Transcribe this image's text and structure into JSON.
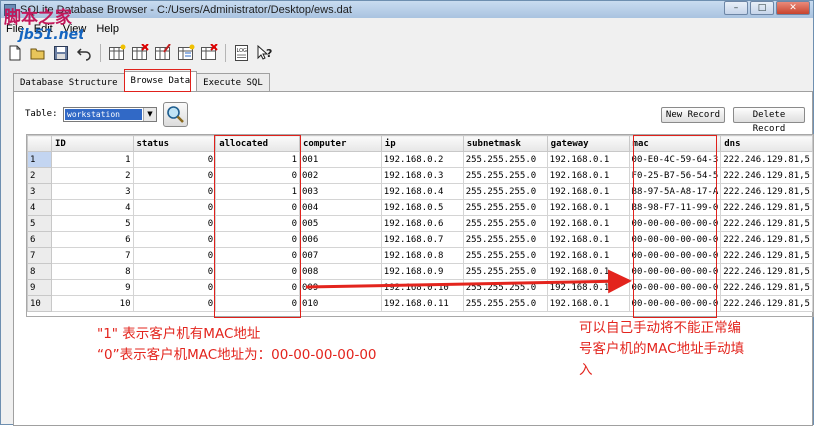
{
  "window": {
    "title": "SQLite Database Browser - C:/Users/Administrator/Desktop/ews.dat"
  },
  "menu": [
    "File",
    "Edit",
    "View",
    "Help"
  ],
  "watermark": {
    "text": "脚本之家",
    "sub": "jb51.net"
  },
  "toolbar": [
    "new-database-icon",
    "open-database-icon",
    "save-database-icon",
    "undo-icon",
    "create-table-icon",
    "delete-table-icon",
    "modify-table-icon",
    "create-index-icon",
    "delete-index-icon",
    "sql-log-icon",
    "whats-this-icon"
  ],
  "tabs": [
    "Database Structure",
    "Browse Data",
    "Execute SQL"
  ],
  "browse": {
    "table_label": "Table:",
    "table_value": "workstation",
    "new_record": "New Record",
    "delete_record": "Delete Record"
  },
  "columns": [
    "ID",
    "status",
    "allocated",
    "computer",
    "ip",
    "subnetmask",
    "gateway",
    "mac",
    "dns"
  ],
  "rows": [
    [
      "1",
      "1",
      "0",
      "1",
      "001",
      "192.168.0.2",
      "255.255.255.0",
      "192.168.0.1",
      "00-E0-4C-59-64-3",
      "222.246.129.81,5"
    ],
    [
      "2",
      "2",
      "0",
      "0",
      "002",
      "192.168.0.3",
      "255.255.255.0",
      "192.168.0.1",
      "F0-25-B7-56-54-5",
      "222.246.129.81,5"
    ],
    [
      "3",
      "3",
      "0",
      "1",
      "003",
      "192.168.0.4",
      "255.255.255.0",
      "192.168.0.1",
      "B8-97-5A-A8-17-A",
      "222.246.129.81,5"
    ],
    [
      "4",
      "4",
      "0",
      "0",
      "004",
      "192.168.0.5",
      "255.255.255.0",
      "192.168.0.1",
      "B8-98-F7-11-99-0",
      "222.246.129.81,5"
    ],
    [
      "5",
      "5",
      "0",
      "0",
      "005",
      "192.168.0.6",
      "255.255.255.0",
      "192.168.0.1",
      "00-00-00-00-00-0",
      "222.246.129.81,5"
    ],
    [
      "6",
      "6",
      "0",
      "0",
      "006",
      "192.168.0.7",
      "255.255.255.0",
      "192.168.0.1",
      "00-00-00-00-00-0",
      "222.246.129.81,5"
    ],
    [
      "7",
      "7",
      "0",
      "0",
      "007",
      "192.168.0.8",
      "255.255.255.0",
      "192.168.0.1",
      "00-00-00-00-00-0",
      "222.246.129.81,5"
    ],
    [
      "8",
      "8",
      "0",
      "0",
      "008",
      "192.168.0.9",
      "255.255.255.0",
      "192.168.0.1",
      "00-00-00-00-00-0",
      "222.246.129.81,5"
    ],
    [
      "9",
      "9",
      "0",
      "0",
      "009",
      "192.168.0.10",
      "255.255.255.0",
      "192.168.0.1",
      "00-00-00-00-00-0",
      "222.246.129.81,5"
    ],
    [
      "10",
      "10",
      "0",
      "0",
      "010",
      "192.168.0.11",
      "255.255.255.0",
      "192.168.0.1",
      "00-00-00-00-00-0",
      "222.246.129.81,5"
    ]
  ],
  "notes": {
    "left_line1": "\"1\" 表示客户机有MAC地址",
    "left_line2": "“0”表示客户机MAC地址为：00-00-00-00-00",
    "right_line1": "可以自己手动将不能正常编",
    "right_line2": "号客户机的MAC地址手动填",
    "right_line3": "入"
  },
  "colors": {
    "annotation": "#e3241d",
    "selection": "#3169c6"
  }
}
